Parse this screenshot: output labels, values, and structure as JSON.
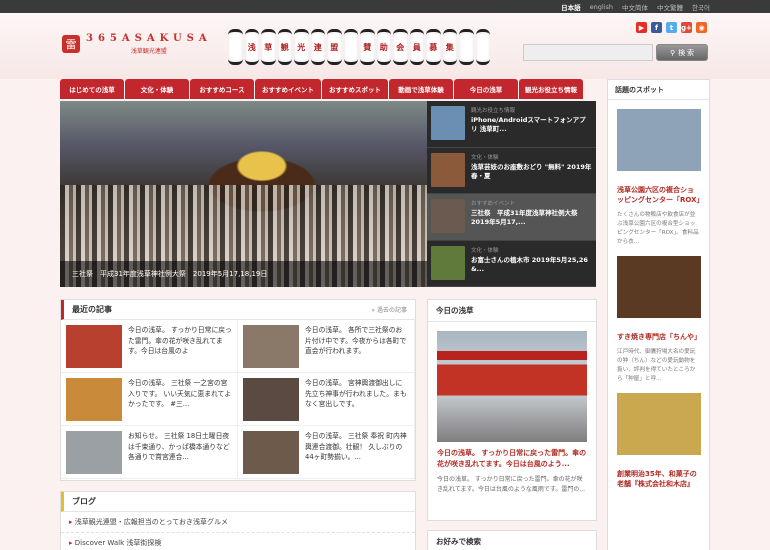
{
  "topbar": {
    "links": [
      {
        "label": "日本語",
        "active": true
      },
      {
        "label": "english",
        "active": false
      },
      {
        "label": "中文简体",
        "active": false
      },
      {
        "label": "中文繁體",
        "active": false
      },
      {
        "label": "한국어",
        "active": false
      }
    ]
  },
  "header": {
    "logo_mark": "雷",
    "logo_main": "365ASAKUSA",
    "logo_sub": "浅草観光連盟",
    "lanterns": [
      "",
      "浅",
      "草",
      "観",
      "光",
      "連",
      "盟",
      "",
      "賛",
      "助",
      "会",
      "員",
      "募",
      "集",
      "",
      ""
    ]
  },
  "social": [
    {
      "name": "youtube",
      "glyph": "▶",
      "color": "#e52d27"
    },
    {
      "name": "facebook",
      "glyph": "f",
      "color": "#3b5998"
    },
    {
      "name": "twitter",
      "glyph": "t",
      "color": "#55acee"
    },
    {
      "name": "googleplus",
      "glyph": "g+",
      "color": "#dd4b39"
    },
    {
      "name": "rss",
      "glyph": "◉",
      "color": "#f26522"
    }
  ],
  "search": {
    "placeholder": "",
    "button_label": "検 索"
  },
  "nav": [
    "はじめての浅草",
    "文化・体験",
    "おすすめコース",
    "おすすめイベント",
    "おすすめスポット",
    "動画で浅草体験",
    "今日の浅草",
    "観光お役立ち情報"
  ],
  "hero": {
    "caption": "三社祭　平成31年度浅草神社例大祭　2019年5月17,18,19日"
  },
  "slides": [
    {
      "category": "観光お役立ち情報",
      "title": "iPhone/Androidスマートフォンアプリ 浅草町...",
      "color": "#6b8fb3"
    },
    {
      "category": "文化・体験",
      "title": "浅草芸妓のお座敷おどり \"無料\" 2019年　春・夏",
      "color": "#8a5a3a"
    },
    {
      "category": "おすすめイベント",
      "title": "三社祭　平成31年度浅草神社例大祭　2019年5月17,...",
      "color": "#6a5a50"
    },
    {
      "category": "文化・体験",
      "title": "お富士さんの植木市 2019年5月25,26 &...",
      "color": "#5f7a3a"
    }
  ],
  "recent": {
    "title": "最近の記事",
    "more": "過去の記事",
    "entries": [
      {
        "text": "今日の浅草。 すっかり日常に戻った雷門。傘の花が咲き乱れてます。今日は台風のよ",
        "color": "#b8402e"
      },
      {
        "text": "今日の浅草。 各所で三社祭のお片付け中です。今夜からは各町で直会が行われます。",
        "color": "#8a7868"
      },
      {
        "text": "今日の浅草。 三社祭 一之宮の宮入りです。 いい天気に恵まれてよかったです。 #三...",
        "color": "#c98a3a"
      },
      {
        "text": "今日の浅草。 宮神輿渡御出しに先立ち神事が行われました。まもなく宮出しです。",
        "color": "#5a4a42"
      },
      {
        "text": "お知らせ。 三社祭 18日土曜日夜は千束通り、かっぱ橋本通りなど各通りで賞宮連合...",
        "color": "#9aa0a4"
      },
      {
        "text": "今日の浅草。 三社祭 奉祝 町内神輿連合渡御。壮観！ 久しぶりの44ヶ町勢揃い。...",
        "color": "#6e5a4a"
      }
    ]
  },
  "today": {
    "heading": "今日の浅草",
    "title": "今日の浅草。 すっかり日常に戻った雷門。傘の花が咲き乱れてます。今日は台風のよう...",
    "desc": "今日の浅草。 すっかり日常に戻った雷門。傘の花が咲き乱れてます。今日は台風のような風雨です。雷門の..."
  },
  "pref": {
    "heading": "お好みで検索"
  },
  "blog": {
    "title": "ブログ",
    "items": [
      "浅草観光連盟・広報担当のとっておき浅草グルメ",
      "Discover Walk 浅草街探検"
    ]
  },
  "sidebar": {
    "heading": "話題のスポット",
    "spots": [
      {
        "title": "浅草公園六区の複合ショッピングセンター「ROX」",
        "desc": "たくさんの物販店や飲食店が並ぶ浅草公園六区の複合型ショッピングセンター「ROX」。食料品から衣...",
        "color": "#8fa3b8"
      },
      {
        "title": "すき焼き専門店「ちんや」",
        "desc": "江戸時代、御鷹狩場大名の愛玩の狆（ちん）などの愛玩動物を扱い、評判を得ていたところから「狆屋」と呼...",
        "color": "#5a3a22"
      },
      {
        "title": "創業明治35年、和菓子の老舗『株式会社和木店』",
        "desc": "",
        "color": "#c9a850"
      }
    ]
  }
}
